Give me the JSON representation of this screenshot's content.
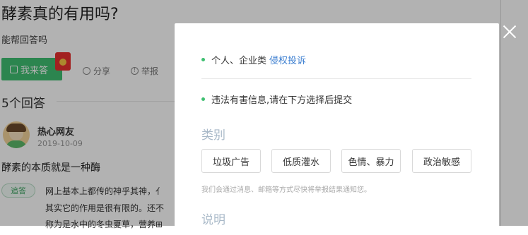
{
  "question": {
    "title": "酵素真的有用吗?",
    "subtitle": "能帮回答吗",
    "answer_button": "我来答",
    "share_label": "分享",
    "report_label": "举报"
  },
  "answers": {
    "count_label": "5个回答",
    "author": "热心网友",
    "date": "2019-10-09",
    "lead": "酵素的本质就是一种酶",
    "tag": "追答",
    "lines": [
      "网上基本上都传的神乎其神，亻",
      "其实它的作用是很有限的。还不",
      "称为是水中的冬虫夏草，营养⊞"
    ]
  },
  "report_modal": {
    "item1_text": "个人、企业类",
    "item1_link": "侵权投诉",
    "item2_text": "违法有害信息,请在下方选择后提交",
    "category_title": "类别",
    "categories": [
      "垃圾广告",
      "低质灌水",
      "色情、暴力",
      "政治敏感"
    ],
    "notice": "我们会通过消息、邮箱等方式尽快将举报结果通知您。",
    "description_title": "说明"
  },
  "colors": {
    "accent_green": "#3fbf71",
    "link_blue": "#3b7ed0",
    "overlay": "rgba(0,0,0,0.3)"
  },
  "icons": [
    "edit-icon",
    "red-packet-icon",
    "share-icon",
    "report-icon",
    "close-icon",
    "avatar"
  ]
}
